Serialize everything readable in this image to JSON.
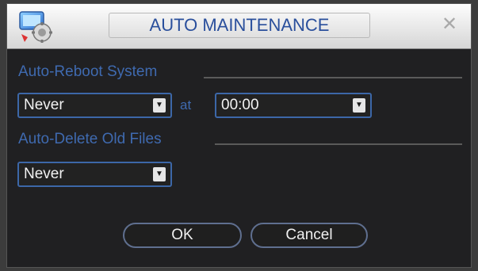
{
  "dialog": {
    "title": "AUTO MAINTENANCE",
    "app_icon": "dvr-app-icon",
    "close_icon": "close-icon"
  },
  "auto_reboot": {
    "label": "Auto-Reboot System",
    "frequency": {
      "value": "Never"
    },
    "at_label": "at",
    "time": {
      "value": "00:00"
    }
  },
  "auto_delete": {
    "label": "Auto-Delete Old Files",
    "period": {
      "value": "Never"
    }
  },
  "buttons": {
    "ok": "OK",
    "cancel": "Cancel"
  },
  "colors": {
    "accent_text": "#3f6ab0",
    "title_text": "#2a4f9c",
    "field_border": "#3c67a8",
    "background": "#202022"
  }
}
